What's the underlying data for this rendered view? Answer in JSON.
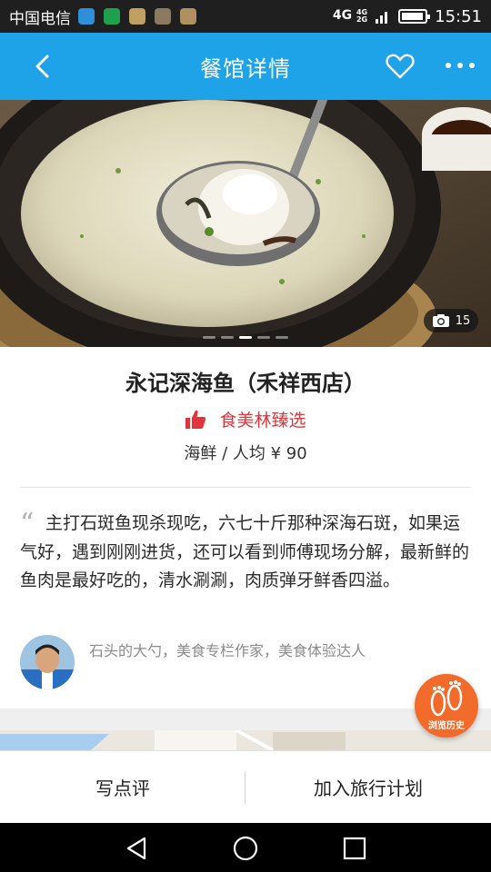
{
  "status_bar": {
    "carrier": "中国电信",
    "network": "4G",
    "network_small_top": "4G",
    "network_small_bottom": "2G",
    "time": "15:51",
    "app_icons": [
      {
        "name": "app-icon-1",
        "color": "#2f8fd8"
      },
      {
        "name": "app-icon-2",
        "color": "#1ea04f"
      },
      {
        "name": "app-icon-3",
        "color": "#c0a060"
      },
      {
        "name": "app-icon-4",
        "color": "#8a7a60"
      },
      {
        "name": "app-icon-5",
        "color": "#b09060"
      }
    ]
  },
  "header": {
    "title": "餐馆详情",
    "back_icon": "back-arrow-icon",
    "favorite_icon": "heart-outline-icon",
    "more_icon": "more-dots-icon",
    "bg_color": "#1fa3e8"
  },
  "hero": {
    "photo_count": "15",
    "camera_icon": "camera-icon",
    "carousel_total": 5,
    "carousel_active": 3
  },
  "restaurant": {
    "name": "永记深海鱼（禾祥西店）",
    "badge_icon": "thumbs-up-icon",
    "badge_label": "食美林臻选",
    "badge_color": "#e2353b",
    "price_line": "海鲜 / 人均 ¥ 90"
  },
  "review": {
    "quote_icon": "quote-icon",
    "text": "主打石斑鱼现杀现吃，六七十斤那种深海石斑，如果运气好，遇到刚刚进货，还可以看到师傅现场分解，最新鲜的鱼肉是最好吃的，清水涮涮，肉质弹牙鲜香四溢。",
    "author": "石头的大勺，美食专栏作家，美食体验达人"
  },
  "floating": {
    "label": "浏览历史",
    "icon": "footprints-icon",
    "color": "#f36b2b"
  },
  "actions": {
    "write_review": "写点评",
    "add_to_plan": "加入旅行计划"
  },
  "navbar": {
    "back": "nav-back-icon",
    "home": "nav-home-icon",
    "recents": "nav-recents-icon"
  }
}
